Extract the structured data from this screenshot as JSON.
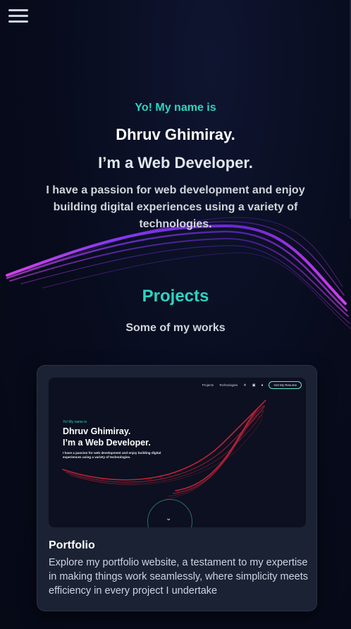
{
  "nav": {
    "menu_icon": "hamburger-menu-icon"
  },
  "hero": {
    "greeting": "Yo! My name is",
    "name": "Dhruv Ghimiray.",
    "role": "I’m a Web Developer.",
    "description": "I have a passion for web development and enjoy building digital experiences using a variety of technologies."
  },
  "projects": {
    "title": "Projects",
    "subtitle": "Some of my works",
    "items": [
      {
        "title": "Portfolio",
        "description": "Explore my portfolio website, a testament to my expertise in making things work seamlessly, where simplicity meets efficiency in every project I undertake",
        "preview": {
          "nav_links": [
            "Projects",
            "Technologies"
          ],
          "nav_icons": [
            "sun-icon",
            "linkedin-icon",
            "github-icon"
          ],
          "resume_button": "Get My Resume",
          "greeting": "Yo! My name is",
          "name": "Dhruv Ghimiray.",
          "role": "I’m a Web Developer.",
          "description": "I have a passion for web development and enjoy building digital experiences using a variety of technologies.",
          "scroll_icon": "chevron-down-icon"
        }
      }
    ]
  },
  "colors": {
    "accent": "#2dd4bf",
    "background": "#070b1c",
    "card": "#1b2233",
    "swoosh_purple": "#8b3cf6",
    "swoosh_magenta": "#e040fb",
    "preview_swoosh": "#d3233a"
  }
}
